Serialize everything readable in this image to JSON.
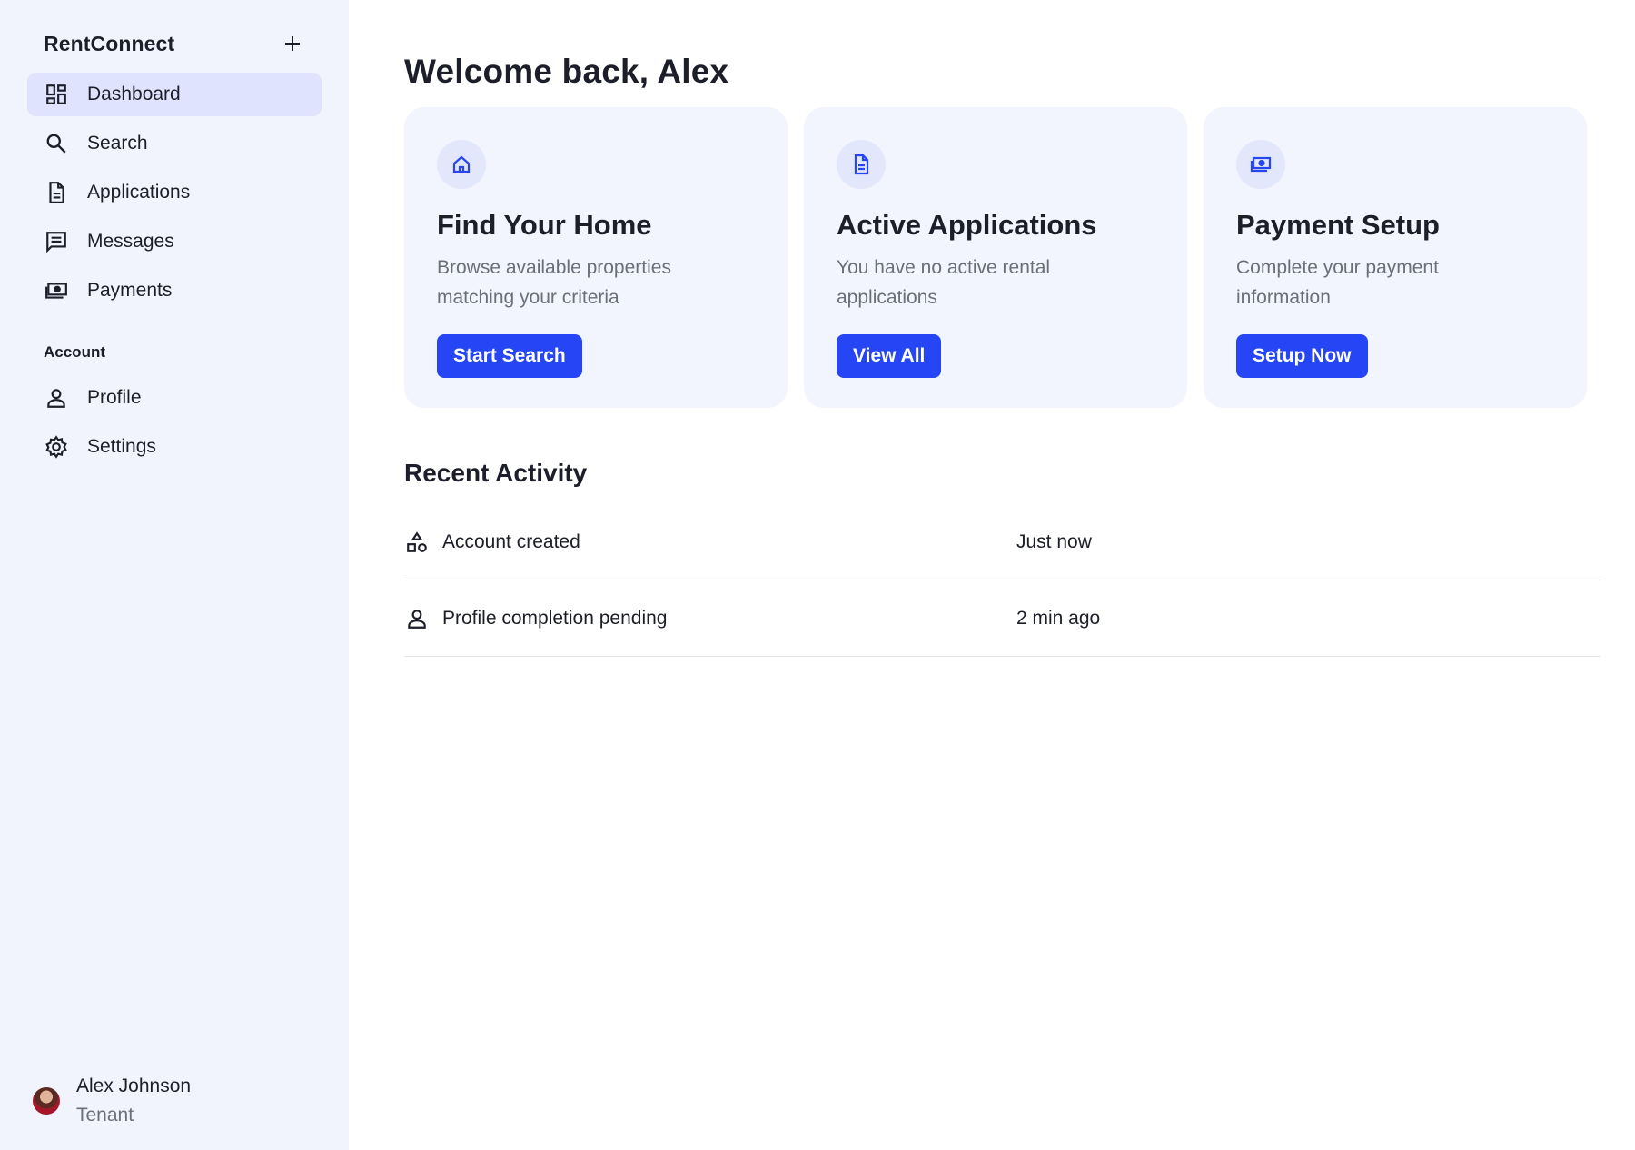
{
  "sidebar": {
    "brand": "RentConnect",
    "add_icon": "plus-icon",
    "nav": [
      {
        "label": "Dashboard",
        "icon": "dashboard-icon",
        "active": true
      },
      {
        "label": "Search",
        "icon": "search-icon",
        "active": false
      },
      {
        "label": "Applications",
        "icon": "document-icon",
        "active": false
      },
      {
        "label": "Messages",
        "icon": "message-icon",
        "active": false
      },
      {
        "label": "Payments",
        "icon": "money-icon",
        "active": false
      }
    ],
    "account_label": "Account",
    "account_nav": [
      {
        "label": "Profile",
        "icon": "person-icon"
      },
      {
        "label": "Settings",
        "icon": "gear-icon"
      }
    ],
    "user": {
      "name": "Alex Johnson",
      "role": "Tenant"
    }
  },
  "main": {
    "title": "Welcome back, Alex",
    "cards": [
      {
        "icon": "home-icon",
        "title": "Find Your Home",
        "description": "Browse available properties matching your criteria",
        "button": "Start Search"
      },
      {
        "icon": "document-icon",
        "title": "Active Applications",
        "description": "You have no active rental applications",
        "button": "View All"
      },
      {
        "icon": "money-icon",
        "title": "Payment Setup",
        "description": "Complete your payment information",
        "button": "Setup Now"
      }
    ],
    "recent_activity_title": "Recent Activity",
    "activity": [
      {
        "icon": "shapes-icon",
        "text": "Account created",
        "time": "Just now"
      },
      {
        "icon": "person-icon",
        "text": "Profile completion pending",
        "time": "2 min ago"
      }
    ]
  },
  "colors": {
    "accent": "#2646f5",
    "sidebar_bg": "#f1f3fd",
    "active_nav_bg": "#dfe3fd",
    "card_bg": "#f2f4fe"
  }
}
